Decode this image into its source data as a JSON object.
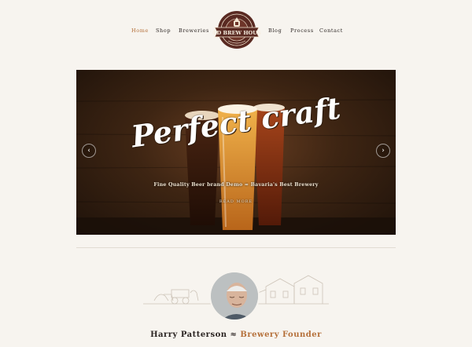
{
  "nav": {
    "left": [
      {
        "label": "Home",
        "active": true
      },
      {
        "label": "Shop",
        "active": false
      },
      {
        "label": "Breweries",
        "active": false
      }
    ],
    "right": [
      {
        "label": "Blog",
        "active": false
      },
      {
        "label": "Process",
        "active": false
      },
      {
        "label": "Contact",
        "active": false
      }
    ]
  },
  "logo": {
    "text": "OLD BREW HOUSE",
    "icon": "brewery-badge-logo"
  },
  "hero": {
    "title": "Perfect craft",
    "subtitle": "Fine Quality Beer brand Demo ≈ Bavaria's Best Brewery",
    "cta": "READ MORE",
    "prev_icon": "‹",
    "next_icon": "›"
  },
  "founder": {
    "name": "Harry Patterson ≈",
    "role": "Brewery Founder"
  },
  "colors": {
    "accent": "#b5703a",
    "text": "#2b2422",
    "background": "#f7f4ef",
    "logo": "#5a2a22"
  }
}
